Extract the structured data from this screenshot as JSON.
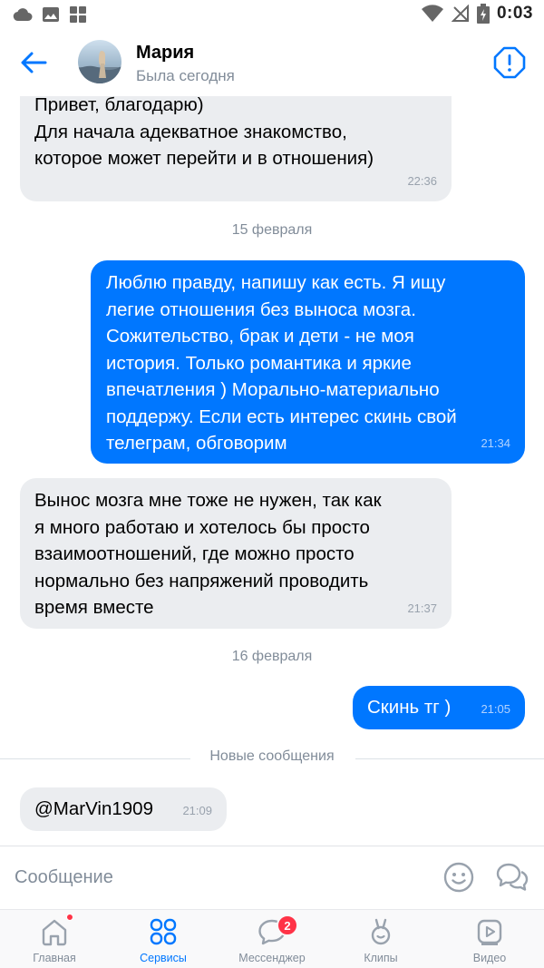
{
  "status_bar": {
    "time": "0:03"
  },
  "header": {
    "contact_name": "Мария",
    "contact_status": "Была сегодня"
  },
  "messages": [
    {
      "direction": "incoming",
      "text": "Привет, благодарю)\nДля начала адекватное знакомство,\nкоторое может перейти и в отношения)",
      "time": "22:36"
    },
    {
      "direction": "outgoing",
      "text": "Люблю правду, напишу как есть. Я ищу\nлегие отношения без выноса мозга.\nСожительство, брак и дети - не моя\nистория. Только романтика и яркие\nвпечатления ) Морально-материально\nподдержу. Если есть интерес скинь свой\nтелеграм, обговорим",
      "time": "21:34"
    },
    {
      "direction": "incoming",
      "text": "Вынос мозга мне тоже не нужен, так как\nя много работаю и хотелось бы просто\nвзаимоотношений, где можно просто\nнормально без напряжений проводить\nвремя вместе",
      "time": "21:37"
    },
    {
      "direction": "outgoing",
      "text": "Скинь тг )",
      "time": "21:05"
    },
    {
      "direction": "incoming",
      "text": "@MarVin1909",
      "time": "21:09"
    }
  ],
  "date_separators": [
    "15 февраля",
    "16 февраля"
  ],
  "new_messages_label": "Новые сообщения",
  "composer": {
    "placeholder": "Сообщение"
  },
  "bottom_nav": {
    "tabs": [
      {
        "label": "Главная",
        "icon": "home-icon",
        "active": false
      },
      {
        "label": "Сервисы",
        "icon": "services-icon",
        "active": true
      },
      {
        "label": "Мессенджер",
        "icon": "messenger-icon",
        "active": false,
        "badge": "2"
      },
      {
        "label": "Клипы",
        "icon": "clips-icon",
        "active": false
      },
      {
        "label": "Видео",
        "icon": "video-icon",
        "active": false
      }
    ]
  },
  "colors": {
    "accent": "#0077ff",
    "incoming_bubble": "#ebedf0",
    "secondary_text": "#818c99",
    "badge": "#ff3347"
  }
}
